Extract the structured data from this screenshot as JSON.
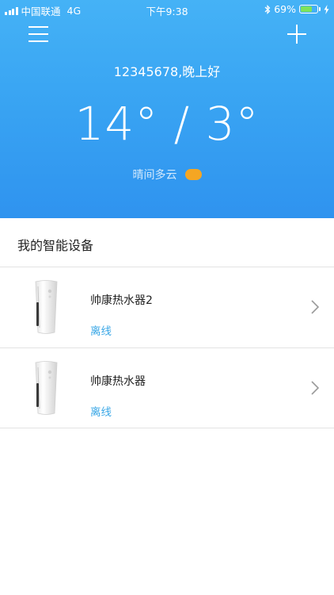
{
  "status_bar": {
    "carrier": "中国联通",
    "network": "4G",
    "time": "下午9:38",
    "battery_percent_text": "69%",
    "battery_level": 0.69
  },
  "header": {
    "greeting": "12345678,晚上好",
    "temperature": "14° / 3°",
    "weather_desc": "晴间多云"
  },
  "devices_section": {
    "title": "我的智能设备",
    "items": [
      {
        "name": "帅康热水器2",
        "status": "离线"
      },
      {
        "name": "帅康热水器",
        "status": "离线"
      }
    ]
  },
  "colors": {
    "header_top": "#45b2f6",
    "header_bottom": "#2f93ef",
    "status_offline": "#3aa7e6",
    "weather_icon": "#f5a623",
    "battery": "#7ee35b"
  },
  "icons": {
    "menu": "menu-icon",
    "add": "plus-icon",
    "weather": "partly-cloudy-icon",
    "device": "water-heater-icon",
    "chevron": "chevron-right-icon"
  }
}
